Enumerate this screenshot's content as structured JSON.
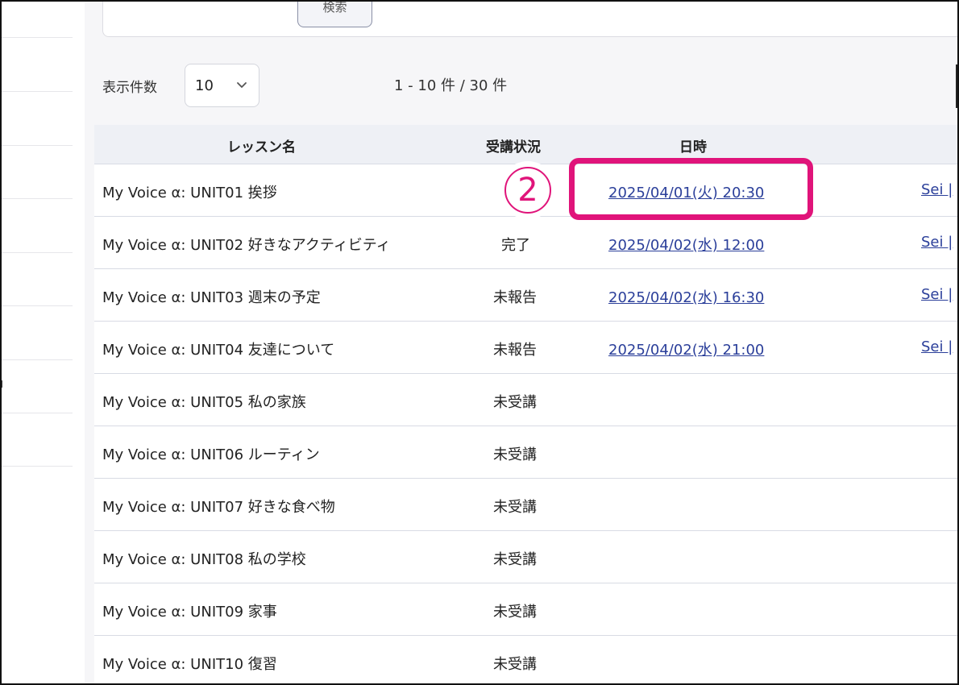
{
  "search": {
    "button_label": "検索"
  },
  "pagination": {
    "per_page_label": "表示件数",
    "per_page_value": "10",
    "range_text": "1 - 10 件 / 30 件"
  },
  "table": {
    "headers": {
      "lesson": "レッスン名",
      "status": "受講状況",
      "datetime": "日時"
    },
    "rows": [
      {
        "name": "My Voice α: UNIT01 挨拶",
        "status": "",
        "datetime": "2025/04/01(火) 20:30",
        "teacher": "Sei |"
      },
      {
        "name": "My Voice α: UNIT02 好きなアクティビティ",
        "status": "完了",
        "datetime": "2025/04/02(水) 12:00",
        "teacher": "Sei |"
      },
      {
        "name": "My Voice α: UNIT03 週末の予定",
        "status": "未報告",
        "datetime": "2025/04/02(水) 16:30",
        "teacher": "Sei |"
      },
      {
        "name": "My Voice α: UNIT04 友達について",
        "status": "未報告",
        "datetime": "2025/04/02(水) 21:00",
        "teacher": "Sei |"
      },
      {
        "name": "My Voice α: UNIT05 私の家族",
        "status": "未受講",
        "datetime": "",
        "teacher": ""
      },
      {
        "name": "My Voice α: UNIT06 ルーティン",
        "status": "未受講",
        "datetime": "",
        "teacher": ""
      },
      {
        "name": "My Voice α: UNIT07 好きな食べ物",
        "status": "未受講",
        "datetime": "",
        "teacher": ""
      },
      {
        "name": "My Voice α: UNIT08 私の学校",
        "status": "未受講",
        "datetime": "",
        "teacher": ""
      },
      {
        "name": "My Voice α: UNIT09 家事",
        "status": "未受講",
        "datetime": "",
        "teacher": ""
      },
      {
        "name": "My Voice α: UNIT10 復習",
        "status": "未受講",
        "datetime": "",
        "teacher": ""
      }
    ]
  },
  "annotation": {
    "step_label": "2",
    "color": "#e0147a"
  },
  "sidebar": {
    "partial_glyph": "ı"
  },
  "colors": {
    "link": "#2b3f9a",
    "header_bg": "#eef0f5",
    "page_bg": "#f6f6f8"
  }
}
